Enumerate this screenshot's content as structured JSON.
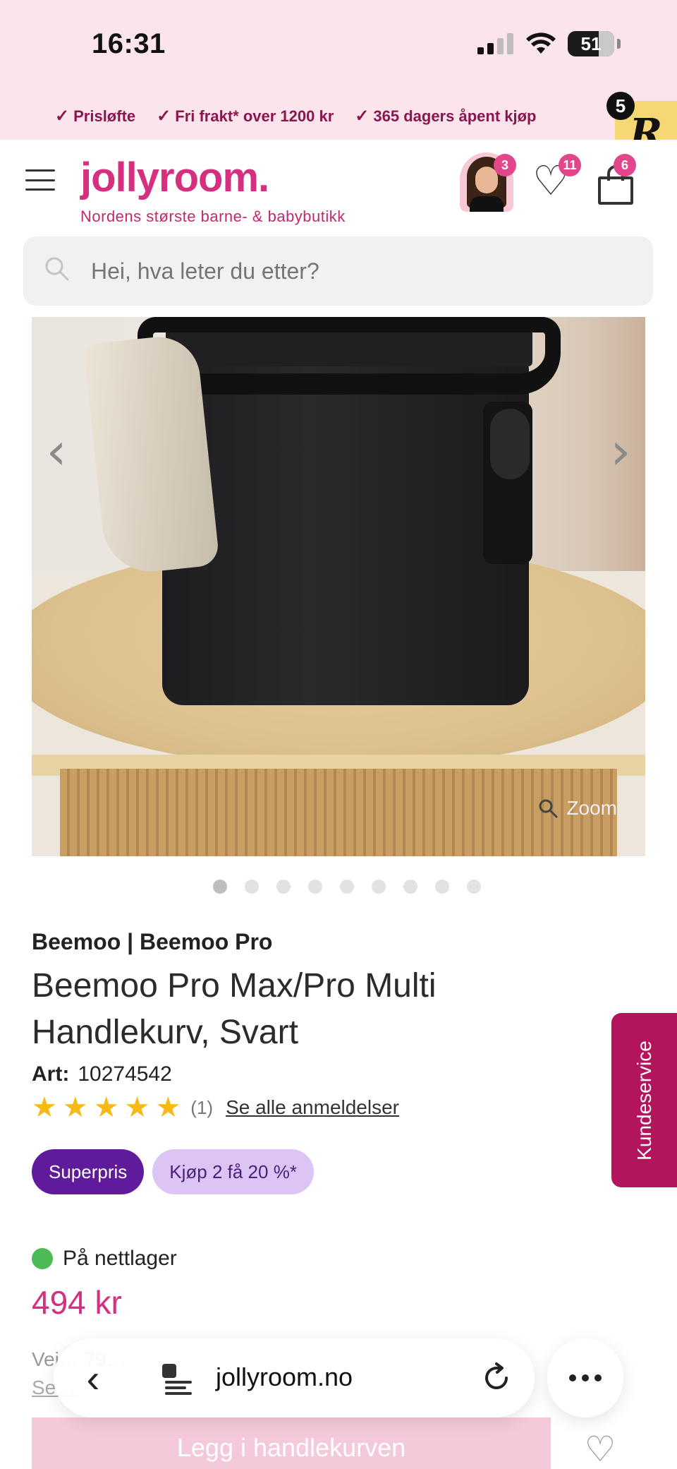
{
  "status_bar": {
    "time": "16:31",
    "battery": "51"
  },
  "promo": {
    "items": [
      {
        "icon": "check-icon",
        "label": "Prisløfte"
      },
      {
        "icon": "check-icon",
        "label": "Fri frakt* over 1200 kr"
      },
      {
        "icon": "check-icon",
        "label": "365 dagers åpent kjøp"
      }
    ],
    "r_badge_letter": "R",
    "r_badge_count": "5"
  },
  "header": {
    "logo": "jollyroom.",
    "tagline": "Nordens største barne- & babybutikk",
    "account_badge": "3",
    "wishlist_badge": "11",
    "cart_badge": "6"
  },
  "search": {
    "placeholder": "Hei, hva leter du etter?"
  },
  "gallery": {
    "zoom_label": "Zoom",
    "dot_count": 9,
    "active_dot": 1
  },
  "product": {
    "brand": "Beemoo | Beemoo Pro",
    "title": "Beemoo Pro Max/Pro Multi Handlekurv, Svart",
    "art_label": "Art:",
    "art_number": "10274542",
    "rating_stars": 5,
    "rating_count": "(1)",
    "reviews_link": "Se alle anmeldelser",
    "tags": [
      "Superpris",
      "Kjøp 2 få 20 %*"
    ],
    "stock": "På nettlager",
    "price": "494 kr",
    "ordinary_price": "Vei… 79…",
    "ordinary_link": "Se…"
  },
  "kundeservice": "Kundeservice",
  "browser": {
    "url": "jollyroom.no"
  },
  "cta": {
    "add_to_cart": "Legg i handlekurven"
  },
  "colors": {
    "brand_pink": "#d4307f",
    "superpris": "#5f1b9c",
    "kundeservice": "#b3155d",
    "in_stock": "#4cbb55"
  }
}
